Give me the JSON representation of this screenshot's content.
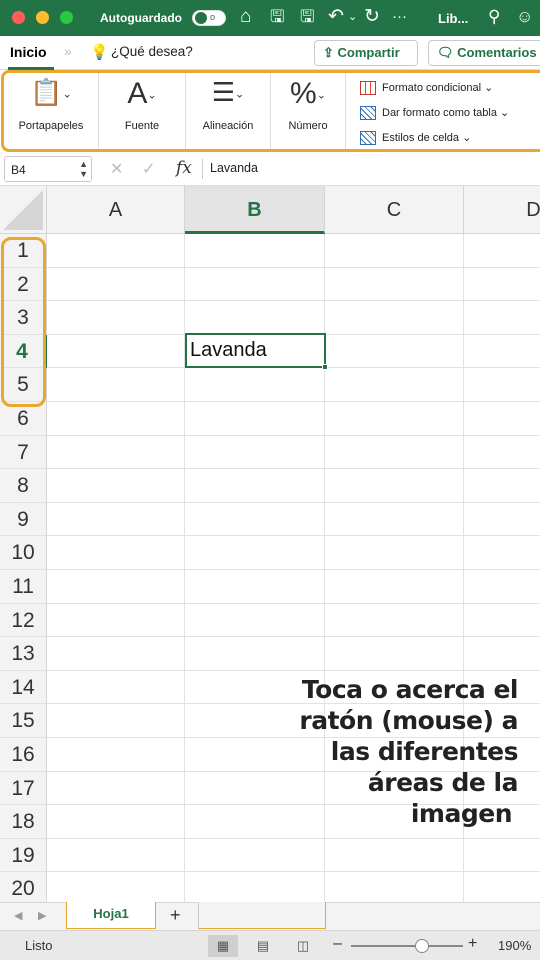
{
  "titlebar": {
    "autosave_label": "Autoguardado",
    "autosave_state": "o",
    "title": "Lib...",
    "icons": [
      "home-icon",
      "save-icon",
      "save-as-icon",
      "undo-icon",
      "redo-icon",
      "more-icon",
      "search-icon",
      "share-person-icon"
    ]
  },
  "tabs": {
    "active": "Inicio",
    "chevrons": "»",
    "search_placeholder": "¿Qué desea?",
    "share": "Compartir",
    "comments": "Comentarios"
  },
  "ribbon": {
    "groups": [
      {
        "label": "Portapapeles",
        "icon": "clipboard-icon"
      },
      {
        "label": "Fuente",
        "glyph": "A"
      },
      {
        "label": "Alineación",
        "icon": "align-icon"
      },
      {
        "label": "Número",
        "glyph": "%"
      }
    ],
    "styles": [
      {
        "label": "Formato condicional"
      },
      {
        "label": "Dar formato como tabla"
      },
      {
        "label": "Estilos de celda"
      }
    ]
  },
  "formula_bar": {
    "name_box": "B4",
    "fx": "fx",
    "value": "Lavanda"
  },
  "grid": {
    "columns": [
      "A",
      "B",
      "C",
      "D"
    ],
    "active_column": "B",
    "rows": [
      "1",
      "2",
      "3",
      "4",
      "5",
      "6",
      "7",
      "8",
      "9",
      "10",
      "11",
      "12",
      "13",
      "14",
      "15",
      "16",
      "17",
      "18",
      "19",
      "20"
    ],
    "active_row": "4",
    "selected_cell_value": "Lavanda"
  },
  "hint": {
    "line1": "Toca o acerca el",
    "line2": "ratón (mouse) a",
    "line3": "las diferentes",
    "line4": "áreas de la",
    "line5": "imagen"
  },
  "sheets": {
    "active": "Hoja1",
    "add": "+"
  },
  "status": {
    "text": "Listo",
    "zoom_minus": "–",
    "zoom_plus": "+",
    "zoom": "190%"
  },
  "colors": {
    "excel_green": "#227447",
    "highlight": "#e8a72e"
  }
}
